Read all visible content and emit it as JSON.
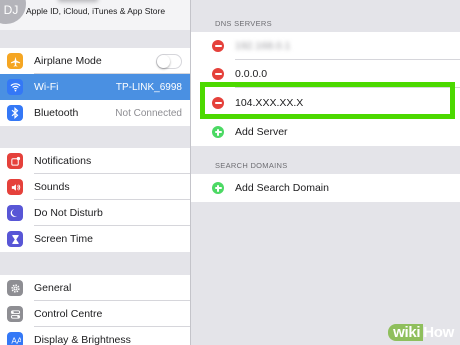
{
  "account": {
    "avatar_initials": "DJ",
    "subtitle": "Apple ID, iCloud, iTunes & App Store"
  },
  "sidebar": {
    "groups": [
      [
        {
          "label": "Airplane Mode",
          "icon": "airplane-icon",
          "color": "#f5a623",
          "control": "toggle",
          "toggle_on": false
        },
        {
          "label": "Wi-Fi",
          "icon": "wifi-icon",
          "color": "#3478f6",
          "value": "TP-LINK_6998",
          "selected": true
        },
        {
          "label": "Bluetooth",
          "icon": "bluetooth-icon",
          "color": "#3478f6",
          "value": "Not Connected"
        }
      ],
      [
        {
          "label": "Notifications",
          "icon": "notifications-icon",
          "color": "#e5413b"
        },
        {
          "label": "Sounds",
          "icon": "sounds-icon",
          "color": "#e5413b"
        },
        {
          "label": "Do Not Disturb",
          "icon": "moon-icon",
          "color": "#5856d6"
        },
        {
          "label": "Screen Time",
          "icon": "hourglass-icon",
          "color": "#5856d6"
        }
      ],
      [
        {
          "label": "General",
          "icon": "gear-icon",
          "color": "#8e8e93"
        },
        {
          "label": "Control Centre",
          "icon": "control-centre-icon",
          "color": "#8e8e93"
        },
        {
          "label": "Display & Brightness",
          "icon": "display-icon",
          "color": "#3478f6"
        }
      ]
    ]
  },
  "dns": {
    "header": "DNS SERVERS",
    "servers": [
      "192.168.0.1",
      "0.0.0.0",
      "104.XXX.XX.X"
    ],
    "add_label": "Add Server"
  },
  "search_domains": {
    "header": "SEARCH DOMAINS",
    "add_label": "Add Search Domain"
  },
  "watermark": {
    "part1": "wiki",
    "part2": "How"
  },
  "colors": {
    "selection": "#4a90e2",
    "delete": "#e5413b",
    "add": "#4cd964",
    "highlight": "#4cd900"
  }
}
